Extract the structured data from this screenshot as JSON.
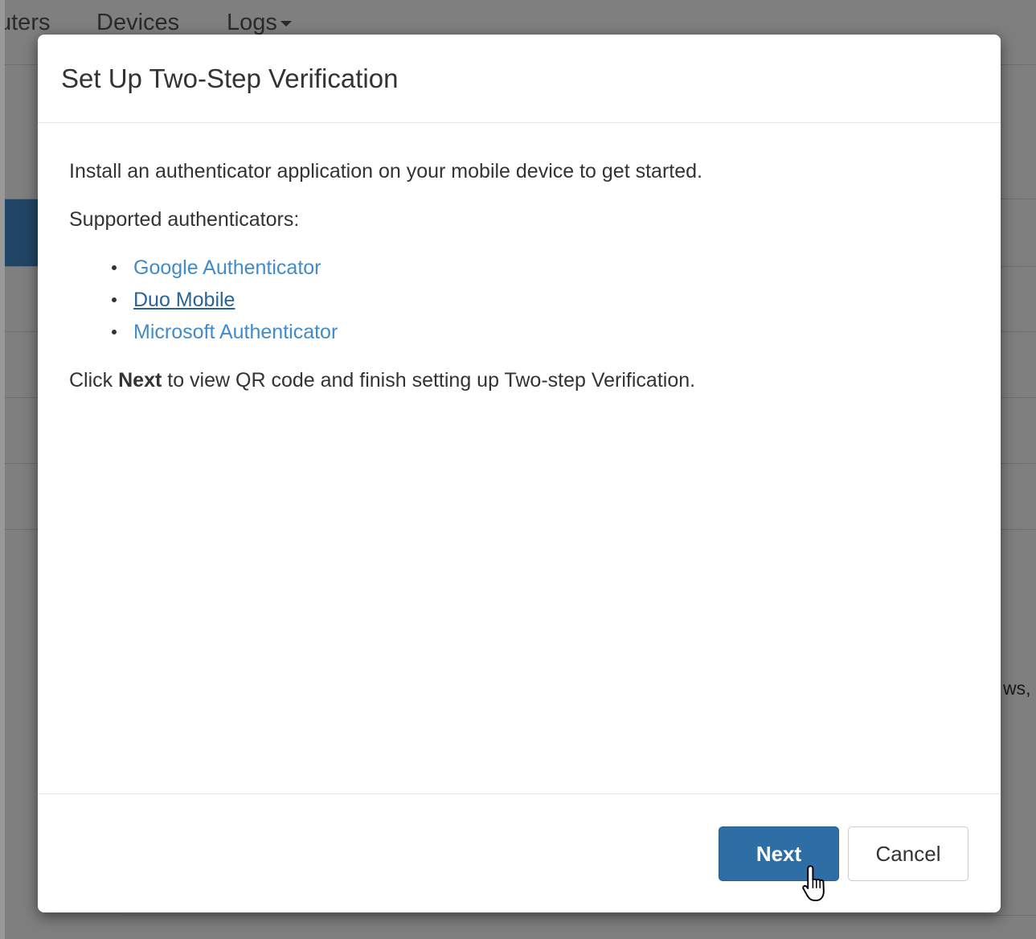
{
  "background": {
    "nav_items": [
      "uters",
      "Devices",
      "Logs"
    ],
    "text_fragment": "ws,"
  },
  "modal": {
    "title": "Set Up Two-Step Verification",
    "intro": "Install an authenticator application on your mobile device to get started.",
    "supported_label": "Supported authenticators:",
    "authenticators": [
      "Google Authenticator",
      "Duo Mobile",
      "Microsoft Authenticator"
    ],
    "hovered_link": "Duo Mobile",
    "instruction_prefix": "Click ",
    "instruction_bold": "Next",
    "instruction_suffix": " to view QR code and finish setting up Two-step Verification.",
    "buttons": {
      "next": "Next",
      "cancel": "Cancel"
    }
  },
  "colors": {
    "link": "#428bca",
    "link_hover": "#2a6496",
    "primary_button": "#2f6ea5"
  },
  "icons": [
    "caret-down-icon",
    "hand-pointer-cursor-icon"
  ]
}
